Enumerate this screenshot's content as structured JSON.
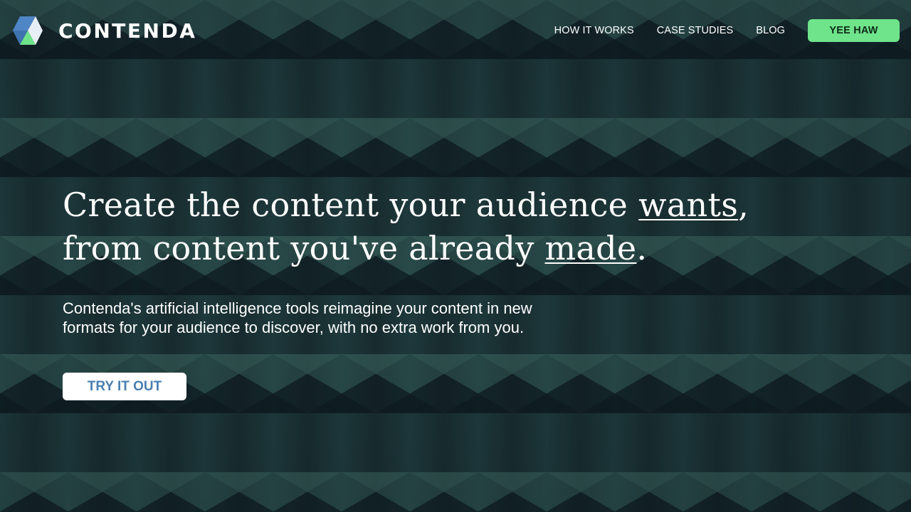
{
  "brand": {
    "name": "CONTENDA",
    "logo_icon": "hexagon-logo-icon"
  },
  "nav": {
    "links": [
      "HOW IT WORKS",
      "CASE STUDIES",
      "BLOG"
    ],
    "cta_label": "YEE HAW"
  },
  "hero": {
    "headline_line1_prefix": "Create the content your audience ",
    "headline_line1_emph": "wants",
    "headline_line1_suffix": ",",
    "headline_line2_prefix": "from content you've already ",
    "headline_line2_emph": "made",
    "headline_line2_suffix": ".",
    "subtext": "Contenda's artificial intelligence tools reimagine your content in new formats for your audience to discover, with no extra work from you.",
    "cta_label": "TRY IT OUT"
  },
  "colors": {
    "accent_green": "#6fe48b",
    "cta_text_blue": "#4a7fb0",
    "logo_blue": "#4f86c6",
    "logo_light": "#e8eef5"
  }
}
